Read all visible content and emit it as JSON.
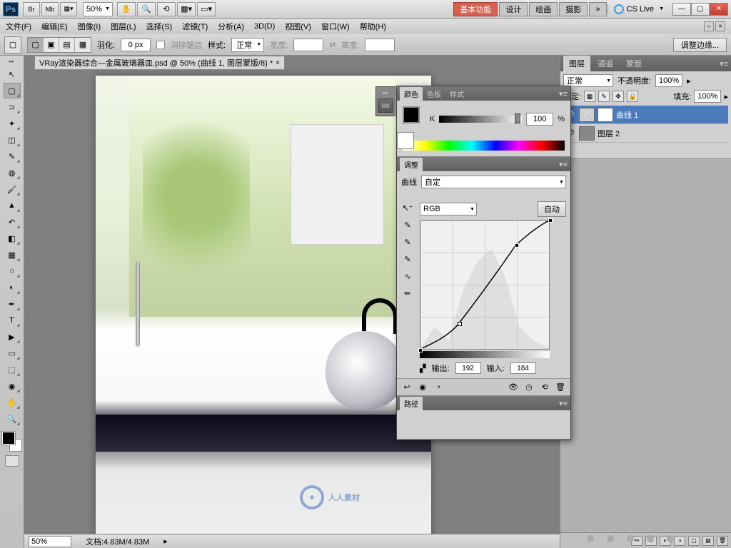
{
  "app": {
    "logo": "Ps",
    "zoom": "50%"
  },
  "workspace_switcher": {
    "active": "基本功能",
    "items": [
      "设计",
      "绘画",
      "摄影"
    ],
    "more": "»",
    "cslive": "CS Live"
  },
  "window_controls": {
    "min": "—",
    "max": "▢",
    "close": "✕"
  },
  "menubar": [
    "文件(F)",
    "编辑(E)",
    "图像(I)",
    "图层(L)",
    "选择(S)",
    "滤镜(T)",
    "分析(A)",
    "3D(D)",
    "视图(V)",
    "窗口(W)",
    "帮助(H)"
  ],
  "options": {
    "feather_label": "羽化:",
    "feather_value": "0 px",
    "antialias": "消除锯齿",
    "style_label": "样式:",
    "style_value": "正常",
    "width_label": "宽度:",
    "height_label": "高度:",
    "refine": "调整边缘..."
  },
  "document": {
    "tab": "VRay渲染器综合—金属玻璃器皿.psd @ 50% (曲线 1, 图层蒙版/8) *"
  },
  "status": {
    "zoom": "50%",
    "doc": "文档:4.83M/4.83M"
  },
  "panels": {
    "layer_tabs": [
      "图层",
      "通道",
      "蒙版"
    ],
    "blend": "正常",
    "opacity_label": "不透明度:",
    "opacity": "100%",
    "lock_label": "锁定:",
    "fill_label": "填充:",
    "fill": "100%",
    "layers": [
      {
        "name": "曲线 1",
        "selected": true
      },
      {
        "name": "图层 2",
        "selected": false
      }
    ]
  },
  "float": {
    "color_tabs": [
      "颜色",
      "色板",
      "样式"
    ],
    "k_label": "K",
    "k_value": "100",
    "pct": "%",
    "adjust_tab": "调整",
    "curves_label": "曲线",
    "preset": "自定",
    "channel": "RGB",
    "auto": "自动",
    "output_label": "输出:",
    "output": "192",
    "input_label": "输入:",
    "input": "184",
    "path_tab": "路径"
  },
  "watermark": "人人素材"
}
